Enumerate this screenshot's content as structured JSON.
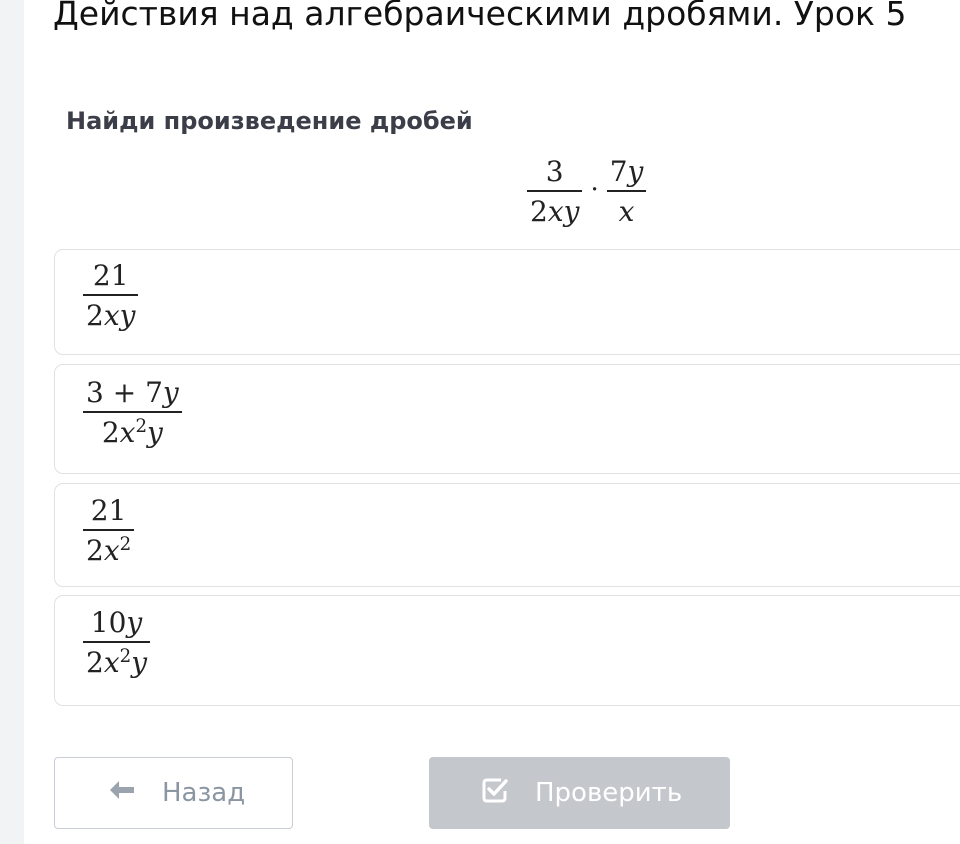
{
  "page": {
    "title": "Действия над алгебраическими дробями. Урок 5"
  },
  "question": {
    "instruction": "Найди произведение дробей",
    "expression": {
      "left": {
        "numerator": "3",
        "denominator": "2xy"
      },
      "operator": "·",
      "right": {
        "numerator": "7y",
        "denominator": "x"
      }
    }
  },
  "options": [
    {
      "numerator": "21",
      "denominator": "2xy"
    },
    {
      "numerator": "3 + 7y",
      "denominator": "2x²y"
    },
    {
      "numerator": "21",
      "denominator": "2x²"
    },
    {
      "numerator": "10y",
      "denominator": "2x²y"
    }
  ],
  "buttons": {
    "back_label": "Назад",
    "check_label": "Проверить",
    "back_icon": "arrow-left-icon",
    "check_icon": "check-square-icon"
  },
  "colors": {
    "check_button_bg": "#c4c7cc",
    "back_button_text": "#8c96a3"
  }
}
